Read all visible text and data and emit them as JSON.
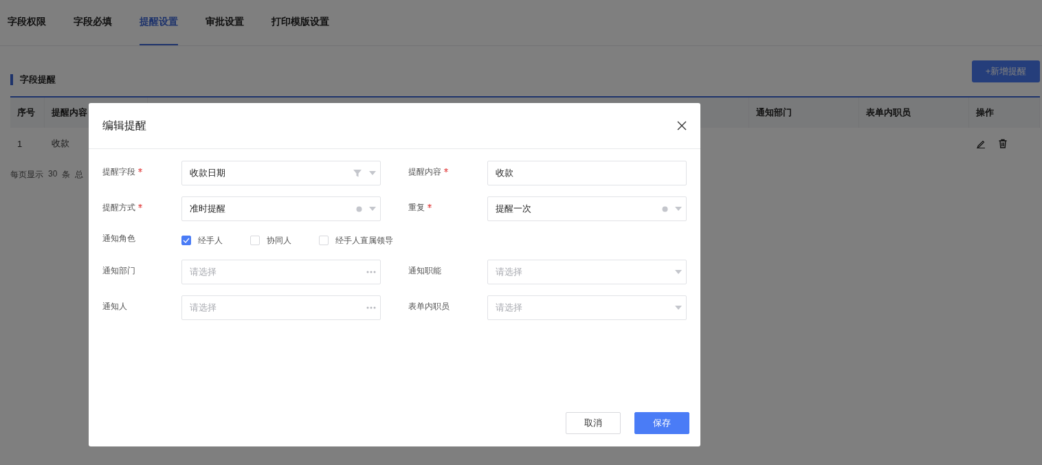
{
  "tabs": [
    {
      "label": "字段权限",
      "selected": false
    },
    {
      "label": "字段必填",
      "selected": false
    },
    {
      "label": "提醒设置",
      "selected": true
    },
    {
      "label": "审批设置",
      "selected": false
    },
    {
      "label": "打印模版设置",
      "selected": false
    }
  ],
  "section": {
    "title": "字段提醒",
    "add_button": "+新增提醒"
  },
  "table": {
    "columns": [
      "序号",
      "提醒内容",
      "",
      "通知部门",
      "表单内职员",
      "操作"
    ],
    "rows": [
      {
        "cells": [
          "1",
          "收款",
          "",
          "",
          "",
          ""
        ]
      }
    ]
  },
  "pagination": {
    "per_page_label": "每页显示",
    "per_page": "30",
    "unit": "条",
    "total_label": "总"
  },
  "dialog": {
    "title": "编辑提醒",
    "rows": [
      {
        "kind": "fields",
        "fields": [
          {
            "label": "提醒字段",
            "required": true,
            "kind": "select",
            "value": "收款日期",
            "filterable": true,
            "clearable": false
          },
          {
            "label": "提醒内容",
            "required": true,
            "kind": "input",
            "value": "收款"
          }
        ]
      },
      {
        "kind": "fields",
        "fields": [
          {
            "label": "提醒方式",
            "required": true,
            "kind": "select",
            "value": "准时提醒",
            "filterable": false,
            "clearable": true
          },
          {
            "label": "重复",
            "required": true,
            "kind": "select",
            "value": "提醒一次",
            "filterable": false,
            "clearable": true
          }
        ]
      },
      {
        "kind": "checks",
        "label": "通知角色",
        "options": [
          {
            "label": "经手人",
            "checked": true
          },
          {
            "label": "协同人",
            "checked": false
          },
          {
            "label": "经手人直属领导",
            "checked": false
          }
        ]
      },
      {
        "kind": "fields",
        "fields": [
          {
            "label": "通知部门",
            "required": false,
            "kind": "picker",
            "placeholder": "请选择"
          },
          {
            "label": "通知职能",
            "required": false,
            "kind": "select",
            "placeholder": "请选择"
          }
        ]
      },
      {
        "kind": "fields",
        "fields": [
          {
            "label": "通知人",
            "required": false,
            "kind": "picker",
            "placeholder": "请选择"
          },
          {
            "label": "表单内职员",
            "required": false,
            "kind": "select",
            "placeholder": "请选择"
          }
        ]
      }
    ],
    "buttons": [
      {
        "label": "取消",
        "kind": "secondary"
      },
      {
        "label": "保存",
        "kind": "primary"
      }
    ]
  }
}
